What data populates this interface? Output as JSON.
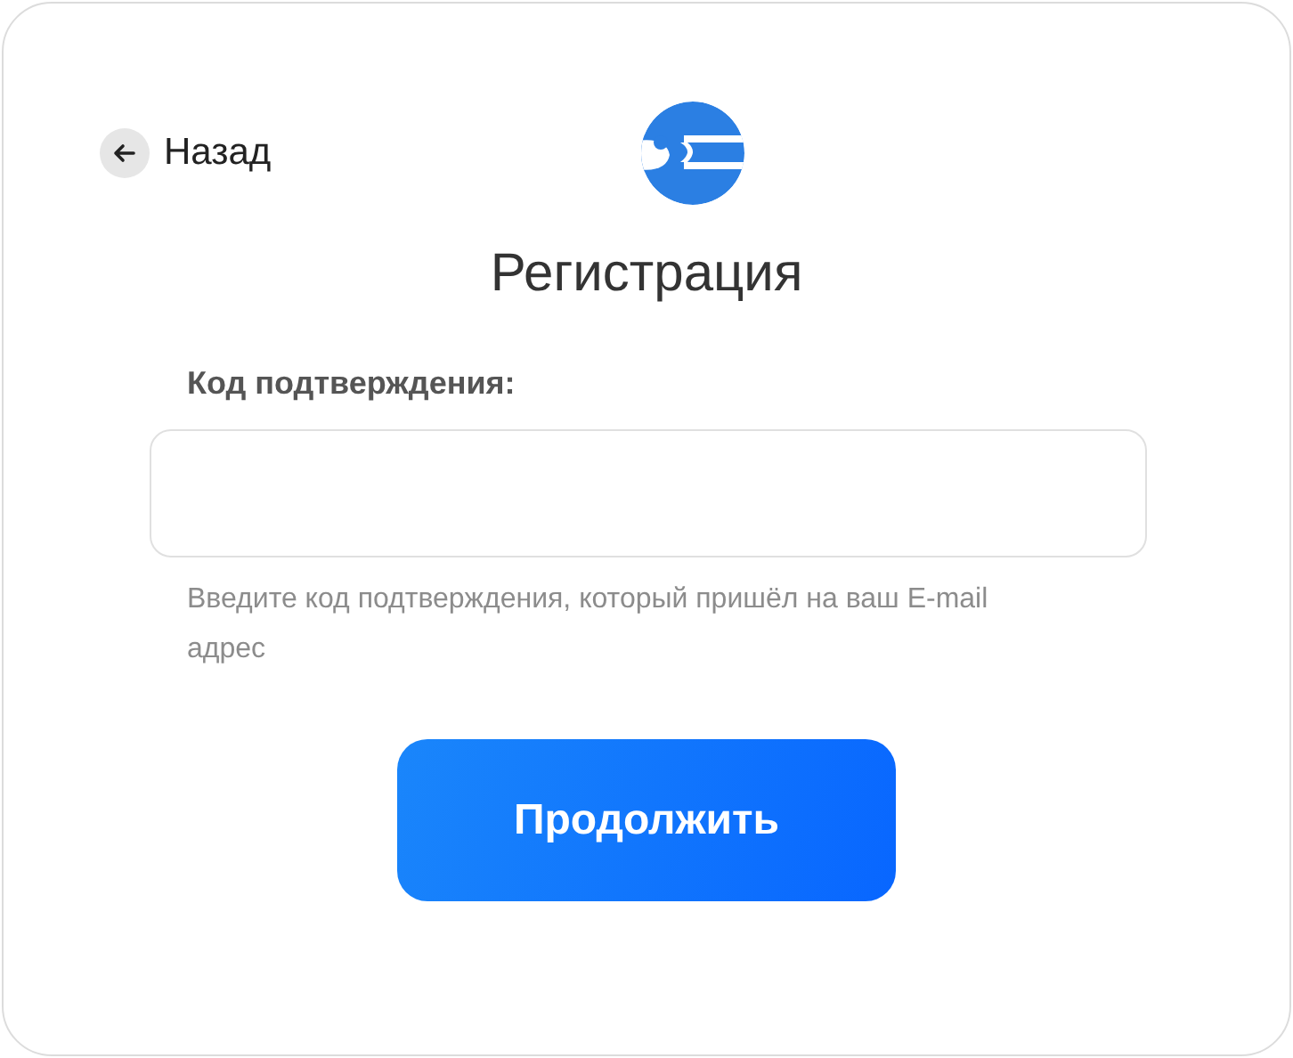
{
  "back_button": {
    "label": "Назад"
  },
  "title": "Регистрация",
  "code_field": {
    "label": "Код подтверждения:",
    "hint": "Введите код подтверждения, который пришёл на ваш E-mail адрес"
  },
  "submit_button": {
    "label": "Продолжить"
  }
}
